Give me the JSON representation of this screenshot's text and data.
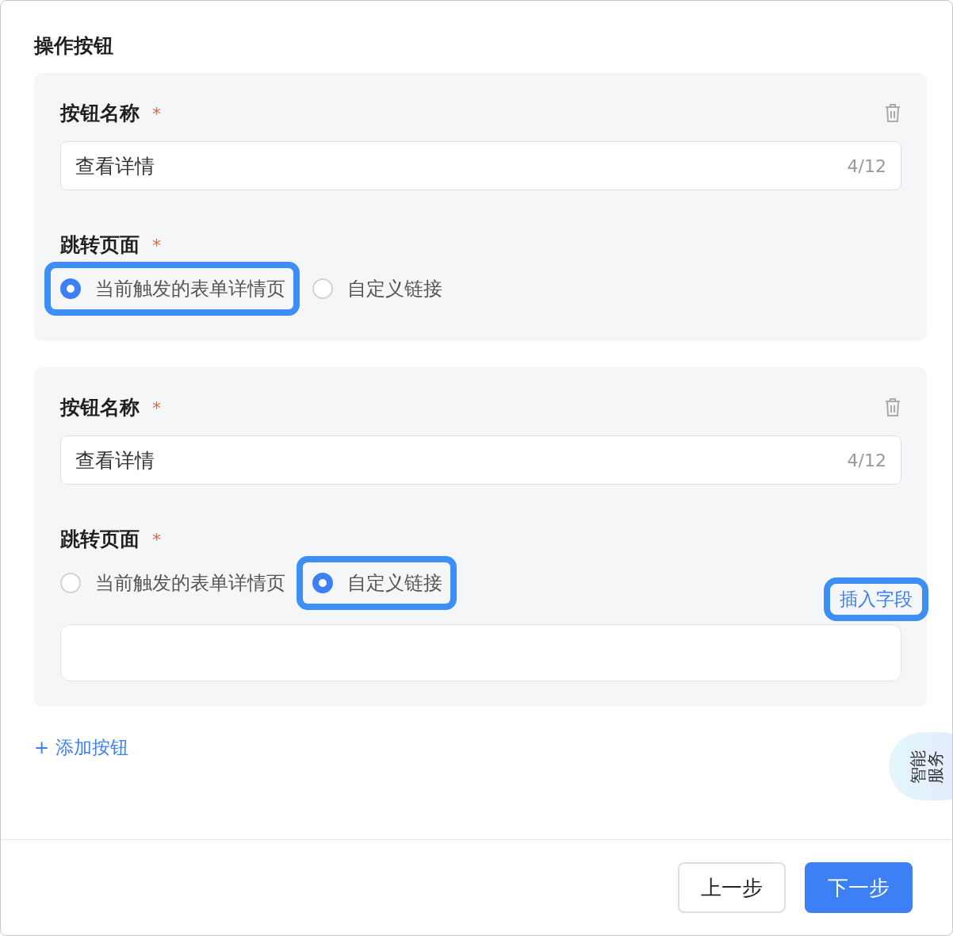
{
  "section_title": "操作按钮",
  "buttons": [
    {
      "name_label": "按钮名称",
      "name_required": "*",
      "name_value": "查看详情",
      "counter": "4/12",
      "target_label": "跳转页面",
      "target_required": "*",
      "options": [
        {
          "label": "当前触发的表单详情页",
          "selected": true,
          "highlighted": true
        },
        {
          "label": "自定义链接",
          "selected": false,
          "highlighted": false
        }
      ]
    },
    {
      "name_label": "按钮名称",
      "name_required": "*",
      "name_value": "查看详情",
      "counter": "4/12",
      "target_label": "跳转页面",
      "target_required": "*",
      "options": [
        {
          "label": "当前触发的表单详情页",
          "selected": false,
          "highlighted": false
        },
        {
          "label": "自定义链接",
          "selected": true,
          "highlighted": true
        }
      ],
      "insert_field": {
        "label": "插入字段",
        "highlighted": true
      }
    }
  ],
  "add_button": "+ 添加按钮",
  "assistant_tab": "智能服务",
  "footer": {
    "prev": "上一步",
    "next": "下一步"
  }
}
